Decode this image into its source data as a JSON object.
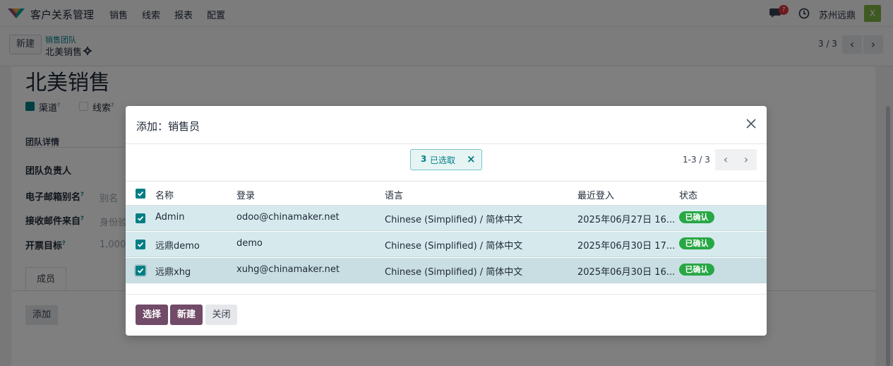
{
  "navbar": {
    "app_title": "客户关系管理",
    "menu": [
      "销售",
      "线索",
      "报表",
      "配置"
    ],
    "chat_badge": "7",
    "company": "苏州远鼎",
    "avatar_letter": "X"
  },
  "control_panel": {
    "new_label": "新建",
    "breadcrumb_parent": "销售团队",
    "breadcrumb_current": "北美销售",
    "pager": "3 / 3"
  },
  "form": {
    "title": "北美销售",
    "checkbox_channel": "渠道",
    "checkbox_leads": "线索",
    "section_team_details": "团队详情",
    "field_team_leader": "团队负责人",
    "field_email_alias": "电子邮箱别名",
    "email_alias_value": "别名",
    "field_accept_from": "接收邮件来自",
    "accept_from_value": "身份验",
    "field_invoice_target": "开票目标",
    "invoice_target_value": "1,000.0",
    "tab_members": "成员",
    "add_label": "添加",
    "help_mark": "?"
  },
  "modal": {
    "title": "添加：销售员",
    "selected_count": "3",
    "selected_label": "已选取",
    "pager": "1-3 / 3",
    "columns": [
      "名称",
      "登录",
      "语言",
      "最近登入",
      "状态"
    ],
    "rows": [
      {
        "name": "Admin",
        "login": "odoo@chinamaker.net",
        "language": "Chinese (Simplified) / 简体中文",
        "last_login": "2025年06月27日 16...",
        "status": "已确认"
      },
      {
        "name": "远鼎demo",
        "login": "demo",
        "language": "Chinese (Simplified) / 简体中文",
        "last_login": "2025年06月30日 17...",
        "status": "已确认"
      },
      {
        "name": "远鼎xhg",
        "login": "xuhg@chinamaker.net",
        "language": "Chinese (Simplified) / 简体中文",
        "last_login": "2025年06月30日 16...",
        "status": "已确认"
      }
    ],
    "select_label": "选择",
    "new_label": "新建",
    "close_label": "关闭"
  }
}
